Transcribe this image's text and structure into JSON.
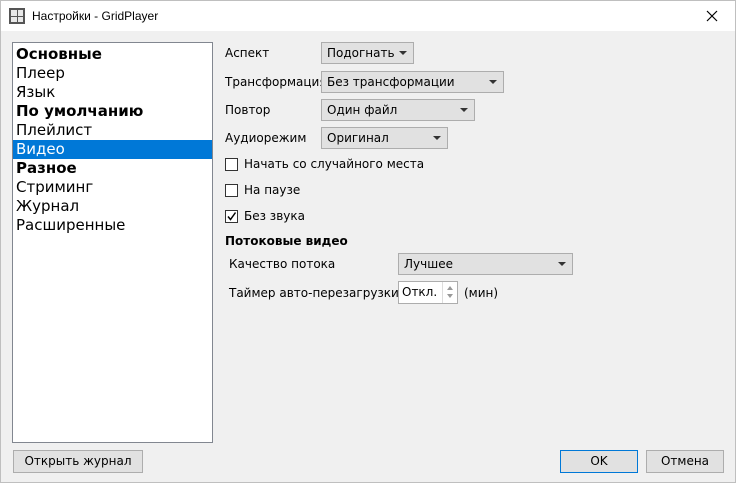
{
  "window": {
    "title": "Настройки - GridPlayer"
  },
  "sidebar": {
    "items": [
      {
        "label": "Основные",
        "bold": true
      },
      {
        "label": "Плеер",
        "bold": false
      },
      {
        "label": "Язык",
        "bold": false
      },
      {
        "label": "По умолчанию",
        "bold": true
      },
      {
        "label": "Плейлист",
        "bold": false
      },
      {
        "label": "Видео",
        "bold": false,
        "selected": true
      },
      {
        "label": "Разное",
        "bold": true
      },
      {
        "label": "Стриминг",
        "bold": false
      },
      {
        "label": "Журнал",
        "bold": false
      },
      {
        "label": "Расширенные",
        "bold": false
      }
    ]
  },
  "video": {
    "aspect_label": "Аспект",
    "aspect_value": "Подогнать",
    "transform_label": "Трансформация",
    "transform_value": "Без трансформации",
    "repeat_label": "Повтор",
    "repeat_value": "Один файл",
    "audio_label": "Аудиорежим",
    "audio_value": "Оригинал",
    "random_start_label": "Начать со случайного места",
    "random_start_checked": false,
    "paused_label": "На паузе",
    "paused_checked": false,
    "muted_label": "Без звука",
    "muted_checked": true
  },
  "streams": {
    "section_title": "Потоковые видео",
    "quality_label": "Качество потока",
    "quality_value": "Лучшее",
    "reload_timer_label": "Таймер авто-перезагрузки",
    "reload_timer_value": "Откл.",
    "reload_timer_unit": "(мин)"
  },
  "footer": {
    "open_log_label": "Открыть журнал",
    "ok_label": "OK",
    "cancel_label": "Отмена"
  },
  "colors": {
    "selection": "#0078d7",
    "accent_border": "#0078d7"
  }
}
